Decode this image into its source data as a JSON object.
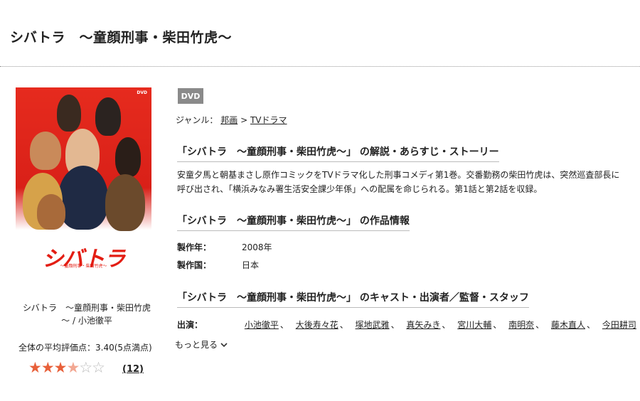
{
  "page": {
    "title": "シバトラ　〜童顔刑事・柴田竹虎〜"
  },
  "cover": {
    "dvd_mark": "DVD",
    "logo_text": "シバトラ",
    "sub_text": "〜童顔刑事・柴田竹虎〜"
  },
  "sidebar": {
    "name_line1": "シバトラ　〜童顔刑事・柴田竹虎",
    "name_line2": "〜 / 小池徹平",
    "average_rating": "全体の平均評価点：3.40(5点満点)",
    "rating_value": 3.4,
    "rating_max": 5,
    "review_count": "12",
    "star_full": "★★★",
    "star_half": "★",
    "star_empty": "☆☆"
  },
  "main": {
    "badge": "DVD",
    "genre_label": "ジャンル：",
    "genre_link1": "邦画",
    "genre_sep": ">",
    "genre_link2": "TVドラマ",
    "section1_title": "「シバトラ　〜童顔刑事・柴田竹虎〜」 の解説・あらすじ・ストーリー",
    "description": "安童夕馬と朝基まさし原作コミックをTVドラマ化した刑事コメディ第1巻。交番勤務の柴田竹虎は、突然巡査部長に呼び出され、「横浜みなみ署生活安全課少年係」への配属を命じられる。第1話と第2話を収録。",
    "section2_title": "「シバトラ　〜童顔刑事・柴田竹虎〜」 の作品情報",
    "info": {
      "year_label": "製作年：",
      "year_value": "2008年",
      "country_label": "製作国：",
      "country_value": "日本"
    },
    "section3_title": "「シバトラ　〜童顔刑事・柴田竹虎〜」 のキャスト・出演者／監督・スタッフ",
    "cast_label": "出演：",
    "cast": [
      "小池徹平",
      "大後寿々花",
      "塚地武雅",
      "真矢みき",
      "宮川大輔",
      "南明奈",
      "藤木直人",
      "今田耕司"
    ],
    "cast_sep": "、",
    "more_label": "もっと見る",
    "more_icon": "chevron-down-icon"
  },
  "colors": {
    "cover_red": "#e31d13",
    "star_on": "#e8603a",
    "badge_gray": "#8a8a8a"
  }
}
